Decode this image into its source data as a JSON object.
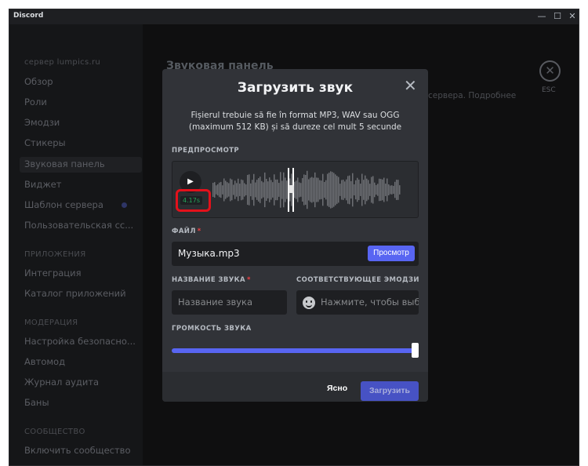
{
  "window": {
    "app_name": "Discord",
    "minimize_glyph": "—",
    "maximize_glyph": "☐",
    "close_glyph": "✕"
  },
  "sidebar": {
    "server_name": "сервер lumpics.ru",
    "items_top": [
      "Обзор",
      "Роли",
      "Эмодзи",
      "Стикеры",
      "Звуковая панель",
      "Виджет",
      "Шаблон сервера",
      "Пользовательская сс..."
    ],
    "apps_header": "ПРИЛОЖЕНИЯ",
    "apps_items": [
      "Интеграция",
      "Каталог приложений"
    ],
    "moderation_header": "МОДЕРАЦИЯ",
    "moderation_items": [
      "Настройка безопасно...",
      "Автомод",
      "Журнал аудита",
      "Баны"
    ],
    "community_header": "СООБЩЕСТВО",
    "community_items": [
      "Включить сообщество"
    ]
  },
  "background": {
    "page_title": "Звуковая панель",
    "partial_text": "сервера. Подробнее",
    "esc_label": "ESC"
  },
  "modal": {
    "title": "Загрузить звук",
    "subtitle": "Fișierul trebuie să fie în format MP3, WAV sau OGG (maximum 512 KB) și să dureze cel mult 5 secunde",
    "preview_label": "ПРЕДПРОСМОТР",
    "duration": "4.17s",
    "file_label": "ФАЙЛ",
    "file_value": "Музыка.mp3",
    "browse_label": "Просмотр",
    "sound_name_label": "НАЗВАНИЕ ЗВУКА",
    "sound_name_placeholder": "Название звука",
    "emoji_label": "СООТВЕТСТВУЮЩЕЕ ЭМОДЗИ",
    "emoji_placeholder": "Нажмите, чтобы выбр...",
    "volume_label": "ГРОМКОСТЬ ЗВУКА",
    "volume_level": 1.0,
    "required_mark": "*",
    "clear_label": "Ясно",
    "upload_label": "Загрузить",
    "close_glyph": "✕",
    "play_glyph": "▶"
  },
  "colors": {
    "accent": "#5865f2",
    "highlight": "#e3111b",
    "duration_text": "#23a55a"
  }
}
